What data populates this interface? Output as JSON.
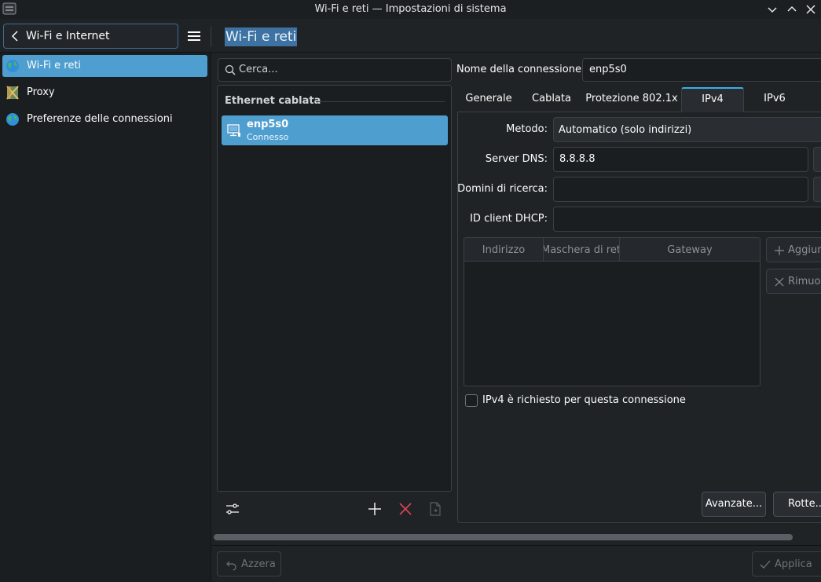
{
  "window": {
    "title": "Wi-Fi e reti — Impostazioni di sistema"
  },
  "header": {
    "back_label": "Wi-Fi e Internet",
    "page_title": "Wi-Fi e reti"
  },
  "sidebar": {
    "items": [
      {
        "label": "Wi-Fi e reti",
        "icon": "globe-icon",
        "active": true
      },
      {
        "label": "Proxy",
        "icon": "proxy-icon",
        "active": false
      },
      {
        "label": "Preferenze delle connessioni",
        "icon": "globe-icon",
        "active": false
      }
    ]
  },
  "connections": {
    "search_placeholder": "Cerca...",
    "group_label": "Ethernet cablata",
    "items": [
      {
        "name": "enp5s0",
        "status": "Connesso",
        "icon": "wired-network-icon"
      }
    ]
  },
  "editor": {
    "name_label": "Nome della connessione:",
    "name_value": "enp5s0",
    "tabs": [
      {
        "label": "Generale",
        "active": false
      },
      {
        "label": "Cablata",
        "active": false
      },
      {
        "label": "Protezione 802.1x",
        "active": false
      },
      {
        "label": "IPv4",
        "active": true
      },
      {
        "label": "IPv6",
        "active": false
      }
    ],
    "ipv4": {
      "method_label": "Metodo:",
      "method_value": "Automatico (solo indirizzi)",
      "dns_label": "Server DNS:",
      "dns_value": "8.8.8.8",
      "search_domains_label": "Domini di ricerca:",
      "search_domains_value": "",
      "dhcp_id_label": "ID client DHCP:",
      "dhcp_id_value": "",
      "table_headers": [
        "Indirizzo",
        "Maschera di rete",
        "Gateway"
      ],
      "table_rows": [],
      "add_label": "Aggiungi",
      "remove_label": "Rimuovi",
      "required_label": "IPv4 è richiesto per questa connessione",
      "required_checked": false,
      "advanced_label": "Avanzate...",
      "routes_label": "Rotte..."
    }
  },
  "footer": {
    "reset_label": "Azzera",
    "apply_label": "Applica"
  },
  "colors": {
    "accent": "#3daee9",
    "selection": "#4f9ed0",
    "background": "#202326",
    "remove_red": "#da4453"
  }
}
